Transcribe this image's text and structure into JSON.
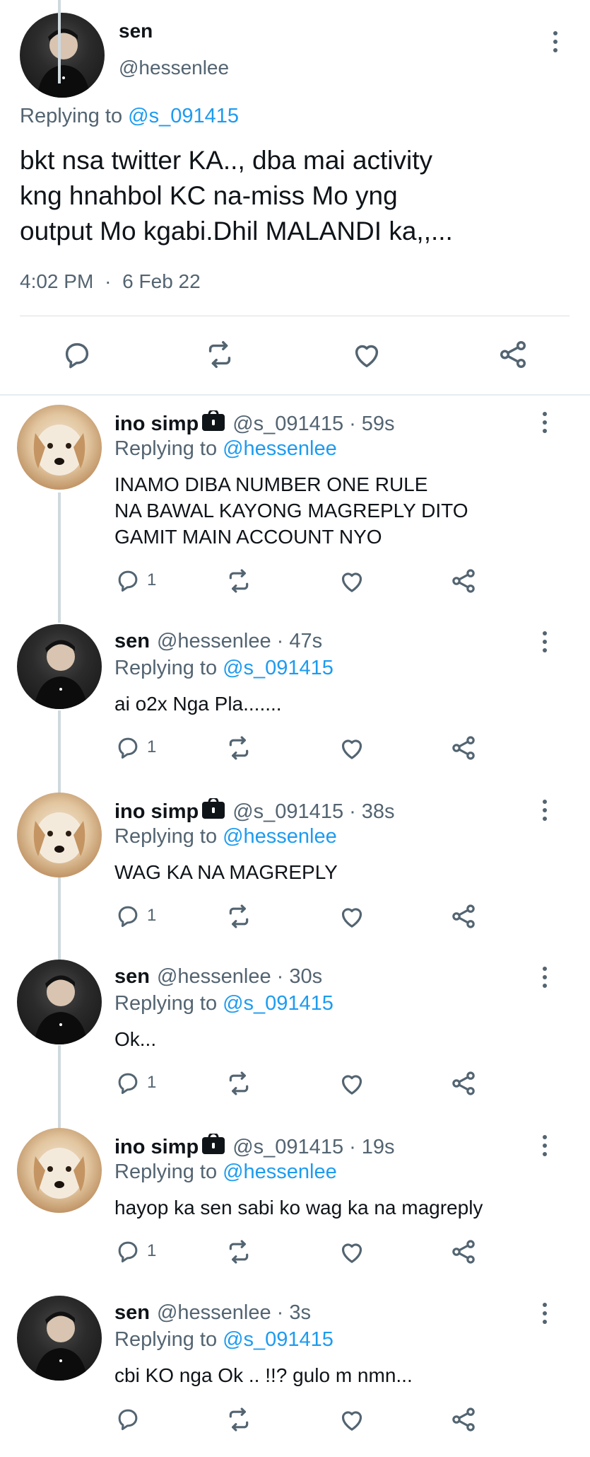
{
  "main_tweet": {
    "name": "sen",
    "handle": "@hessenlee",
    "replying_prefix": "Replying to",
    "replying_to": "@s_091415",
    "text_lines": [
      "bkt nsa twitter KA.., dba mai activity",
      "kng hnahbol KC na-miss Mo yng",
      "output Mo kgabi.Dhil MALANDI ka,,..."
    ],
    "time": "4:02 PM",
    "separator": "·",
    "date": "6 Feb 22"
  },
  "replies": [
    {
      "name": "ino simp",
      "locked": true,
      "handle": "@s_091415",
      "dot": "·",
      "time": "59s",
      "replying_prefix": "Replying to",
      "replying_to": "@hessenlee",
      "text_lines": [
        "INAMO DIBA NUMBER ONE RULE",
        "NA BAWAL KAYONG MAGREPLY DITO",
        "GAMIT MAIN ACCOUNT NYO"
      ],
      "reply_count": "1",
      "avatar": "dog"
    },
    {
      "name": "sen",
      "locked": false,
      "handle": "@hessenlee",
      "dot": "·",
      "time": "47s",
      "replying_prefix": "Replying to",
      "replying_to": "@s_091415",
      "text_lines": [
        "ai o2x Nga Pla......."
      ],
      "reply_count": "1",
      "avatar": "dark"
    },
    {
      "name": "ino simp",
      "locked": true,
      "handle": "@s_091415",
      "dot": "·",
      "time": "38s",
      "replying_prefix": "Replying to",
      "replying_to": "@hessenlee",
      "text_lines": [
        "WAG KA NA MAGREPLY"
      ],
      "reply_count": "1",
      "avatar": "dog"
    },
    {
      "name": "sen",
      "locked": false,
      "handle": "@hessenlee",
      "dot": "·",
      "time": "30s",
      "replying_prefix": "Replying to",
      "replying_to": "@s_091415",
      "text_lines": [
        "Ok..."
      ],
      "reply_count": "1",
      "avatar": "dark"
    },
    {
      "name": "ino simp",
      "locked": true,
      "handle": "@s_091415",
      "dot": "·",
      "time": "19s",
      "replying_prefix": "Replying to",
      "replying_to": "@hessenlee",
      "text_lines": [
        "hayop ka sen sabi ko wag ka na magreply"
      ],
      "reply_count": "1",
      "avatar": "dog"
    },
    {
      "name": "sen",
      "locked": false,
      "handle": "@hessenlee",
      "dot": "·",
      "time": "3s",
      "replying_prefix": "Replying to",
      "replying_to": "@s_091415",
      "text_lines": [
        "cbi KO nga Ok .. !!? gulo m nmn..."
      ],
      "reply_count": "",
      "avatar": "dark"
    }
  ],
  "icons": {
    "reply": "reply-bubble-icon",
    "retweet": "retweet-icon",
    "like": "heart-icon",
    "share": "share-icon",
    "more": "more-dots-icon",
    "lock": "lock-icon"
  },
  "colors": {
    "text": "#0f1419",
    "muted": "#536471",
    "link": "#1d9bf0",
    "divider": "#cfd9de"
  }
}
